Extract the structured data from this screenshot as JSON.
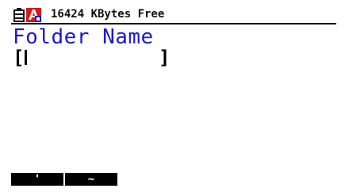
{
  "status_bar": {
    "battery_icon": "battery-icon",
    "mode_icon": "alpha-lock-icon",
    "free_memory": "16424 KBytes Free"
  },
  "title": "Folder Name",
  "input": {
    "open_bracket": "[",
    "close_bracket": "]",
    "value": ""
  },
  "fkeys": [
    {
      "label": "'"
    },
    {
      "label": "~"
    }
  ],
  "colors": {
    "title": "#1a1acc",
    "text": "#000000",
    "fkey_bg": "#000000",
    "fkey_text": "#ffffff",
    "icon_red": "#d81818",
    "icon_blue": "#1a1acc"
  }
}
